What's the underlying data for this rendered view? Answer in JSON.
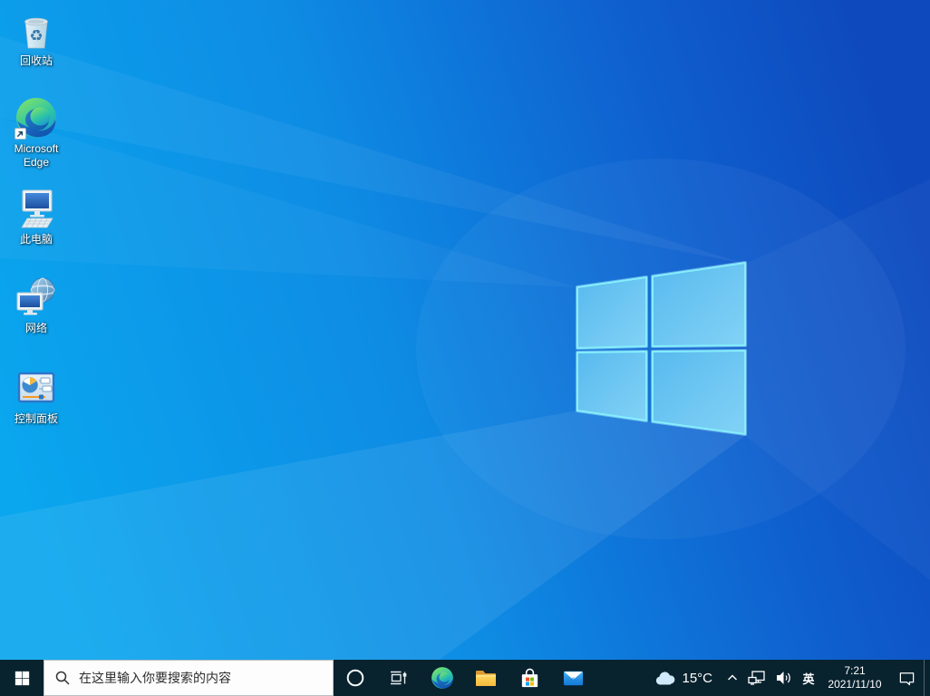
{
  "desktop": {
    "icons": [
      {
        "label": "回收站"
      },
      {
        "label": "Microsoft Edge"
      },
      {
        "label": "此电脑"
      },
      {
        "label": "网络"
      },
      {
        "label": "控制面板"
      }
    ]
  },
  "taskbar": {
    "search": {
      "placeholder": "在这里输入你要搜索的内容"
    },
    "app_icons": [
      "start",
      "cortana",
      "task-view",
      "microsoft-edge",
      "file-explorer",
      "microsoft-store",
      "mail"
    ],
    "tray": {
      "weather_icon": "cloud-icon",
      "temperature": "15°C",
      "language": "英",
      "time": "7:21",
      "date": "2021/11/10"
    }
  },
  "colors": {
    "taskbar_bg": "#08222e",
    "wallpaper_left": "#0aa6ee",
    "wallpaper_right": "#0e4abe",
    "logo_pane": "#66c6f2",
    "logo_edge": "#85eefc",
    "search_bg": "#fdfdfd"
  }
}
